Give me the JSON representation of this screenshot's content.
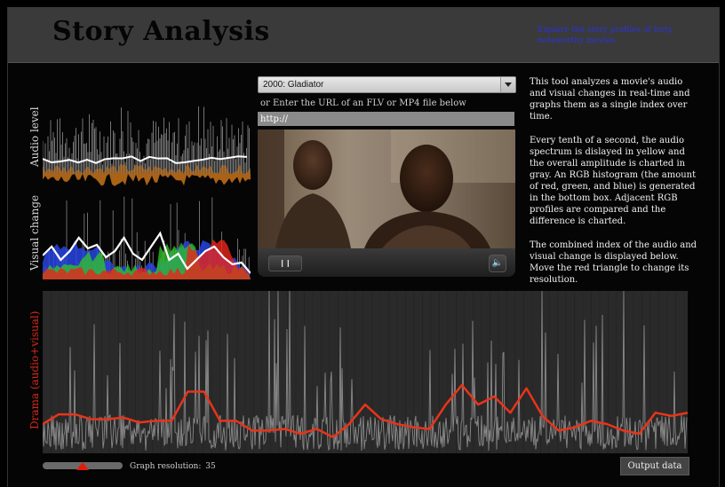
{
  "header": {
    "title": "Story Analysis",
    "link_text": "Explore the story profiles of forty noteworthy movies."
  },
  "small_graphs": {
    "audio_label": "Audio level",
    "visual_label": "Visual change"
  },
  "player": {
    "movie_select": "2000: Gladiator",
    "url_label": "or Enter the URL of an FLV or MP4 file below",
    "url_value": "http://",
    "pause_icon": "pause-icon",
    "volume_icon": "speaker-icon"
  },
  "description": [
    "This tool analyzes a movie's audio and visual changes in real-time and graphs them as a single index over time.",
    "Every tenth of a second, the audio spectrum is dislayed in yellow and the overall amplitude is charted in gray. An RGB histogram (the amount of red, green, and blue) is generated in the bottom box. Adjacent RGB profiles are compared and the difference is charted.",
    "The combined index of the audio and visual change is displayed below. Move the red triangle to change its resolution."
  ],
  "drama": {
    "label": "Drama (audio+visual)",
    "trend": [
      0.18,
      0.24,
      0.24,
      0.21,
      0.21,
      0.22,
      0.19,
      0.2,
      0.2,
      0.38,
      0.38,
      0.2,
      0.2,
      0.14,
      0.14,
      0.15,
      0.12,
      0.15,
      0.1,
      0.18,
      0.3,
      0.21,
      0.18,
      0.16,
      0.15,
      0.3,
      0.42,
      0.3,
      0.35,
      0.25,
      0.4,
      0.23,
      0.14,
      0.16,
      0.2,
      0.18,
      0.14,
      0.12,
      0.25,
      0.23,
      0.25
    ]
  },
  "controls": {
    "resolution_label": "Graph resolution:",
    "resolution_value": "35",
    "resolution_fraction": 0.5,
    "output_button": "Output data"
  },
  "colors": {
    "audio_spectrum": "#c8731a",
    "amplitude": "#bfbfbf",
    "red": "#e8251a",
    "green": "#32c824",
    "blue": "#2744e0",
    "trend": "#e8341a"
  }
}
